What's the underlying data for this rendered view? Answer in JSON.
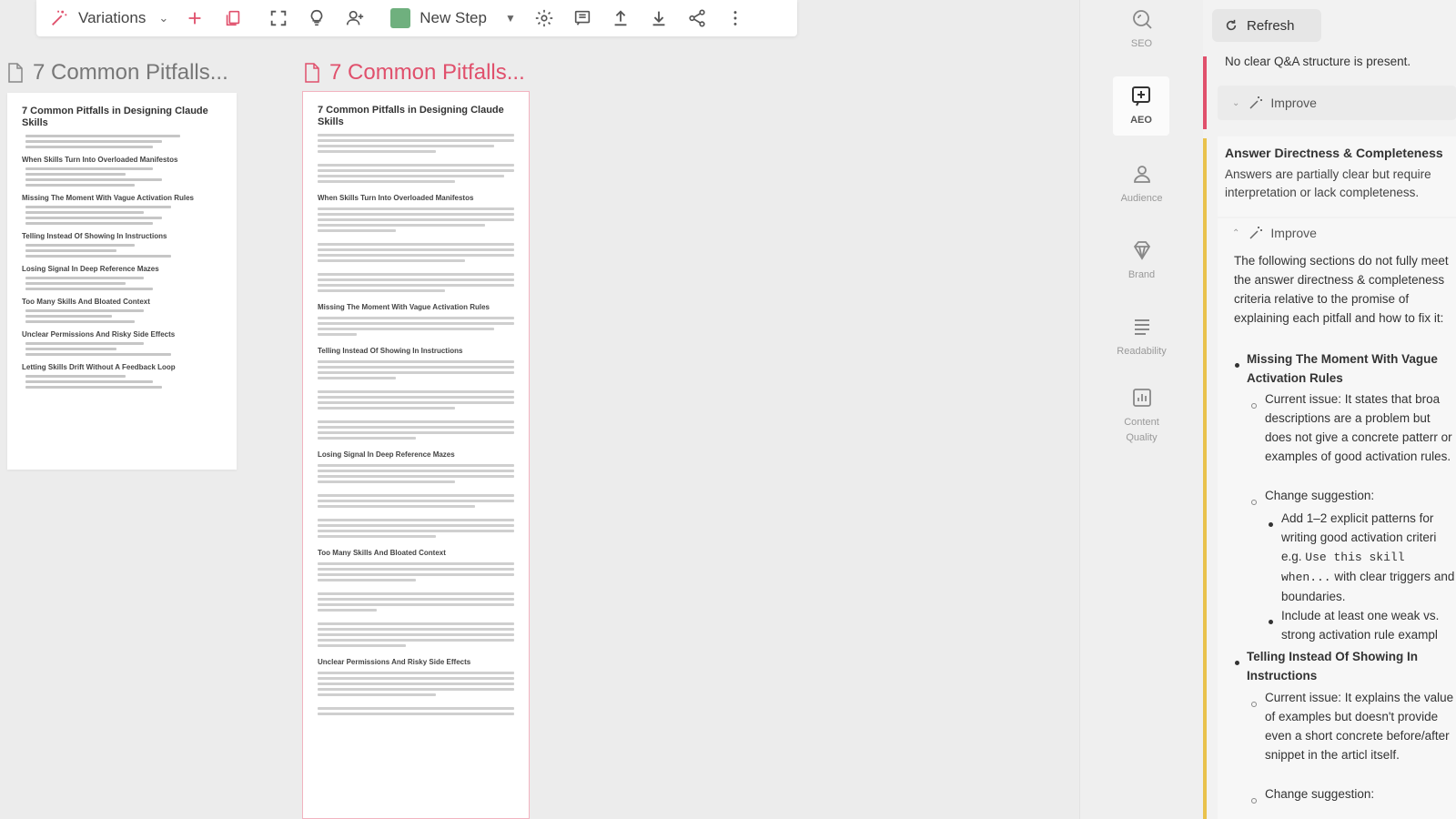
{
  "toolbar": {
    "variations_label": "Variations",
    "step_label": "New Step",
    "step_color": "#6fb07e",
    "icons": [
      "magic-wand-icon",
      "plus-icon",
      "copy-icon",
      "fullscreen-icon",
      "lightbulb-icon",
      "add-user-icon",
      "settings-icon",
      "comment-icon",
      "upload-icon",
      "download-icon",
      "share-icon",
      "more-icon"
    ]
  },
  "docs": [
    {
      "header": "7 Common Pitfalls...",
      "title": "7 Common Pitfalls in Designing Claude Skills",
      "sections": [
        "When Skills Turn Into Overloaded Manifestos",
        "Missing The Moment With Vague Activation Rules",
        "Telling Instead Of Showing In Instructions",
        "Losing Signal In Deep Reference Mazes",
        "Too Many Skills And Bloated Context",
        "Unclear Permissions And Risky Side Effects",
        "Letting Skills Drift Without A Feedback Loop"
      ]
    },
    {
      "header": "7 Common Pitfalls...",
      "title": "7 Common Pitfalls in Designing Claude Skills",
      "sections": [
        "When Skills Turn Into Overloaded Manifestos",
        "Missing The Moment With Vague Activation Rules",
        "Telling Instead Of Showing In Instructions",
        "Losing Signal In Deep Reference Mazes",
        "Too Many Skills And Bloated Context",
        "Unclear Permissions And Risky Side Effects"
      ]
    }
  ],
  "rail": {
    "items": [
      {
        "label": "SEO",
        "icon": "seo-icon"
      },
      {
        "label": "AEO",
        "icon": "aeo-icon"
      },
      {
        "label": "Audience",
        "icon": "audience-icon"
      },
      {
        "label": "Brand",
        "icon": "brand-icon"
      },
      {
        "label": "Readability",
        "icon": "readability-icon"
      },
      {
        "label": "Content Quality",
        "icon": "content-quality-icon"
      }
    ]
  },
  "panel": {
    "refresh_label": "Refresh",
    "qa_note": "No clear Q&A structure is present.",
    "improve_label": "Improve",
    "section_title": "Answer Directness & Completeness",
    "section_desc": "Answers are partially clear but require interpretation or lack completeness.",
    "intro": "The following sections do not fully meet the answer directness & completeness criteria relative to the promise of explaining each pitfall and how to fix it:",
    "item1_title": "Missing The Moment With Vague Activation Rules",
    "item1_issue": "Current issue: It states that broa descriptions are a problem but does not give a concrete patterr or examples of good activation rules.",
    "change_label": "Change suggestion:",
    "item1_sugg1_pre": "Add 1–2 explicit patterns for writing good activation criteri e.g. ",
    "item1_sugg1_code": "Use this skill when...",
    "item1_sugg1_post": " with clear triggers and boundaries.",
    "item1_sugg2": "Include at least one weak vs. strong activation rule exampl",
    "item2_title": "Telling Instead Of Showing In Instructions",
    "item2_issue": "Current issue: It explains the value of examples but doesn't provide even a short concrete before/after snippet in the articl itself.",
    "item2_change": "Change suggestion:"
  },
  "colors": {
    "accent": "#e0506c",
    "warning": "#e9c24c"
  }
}
